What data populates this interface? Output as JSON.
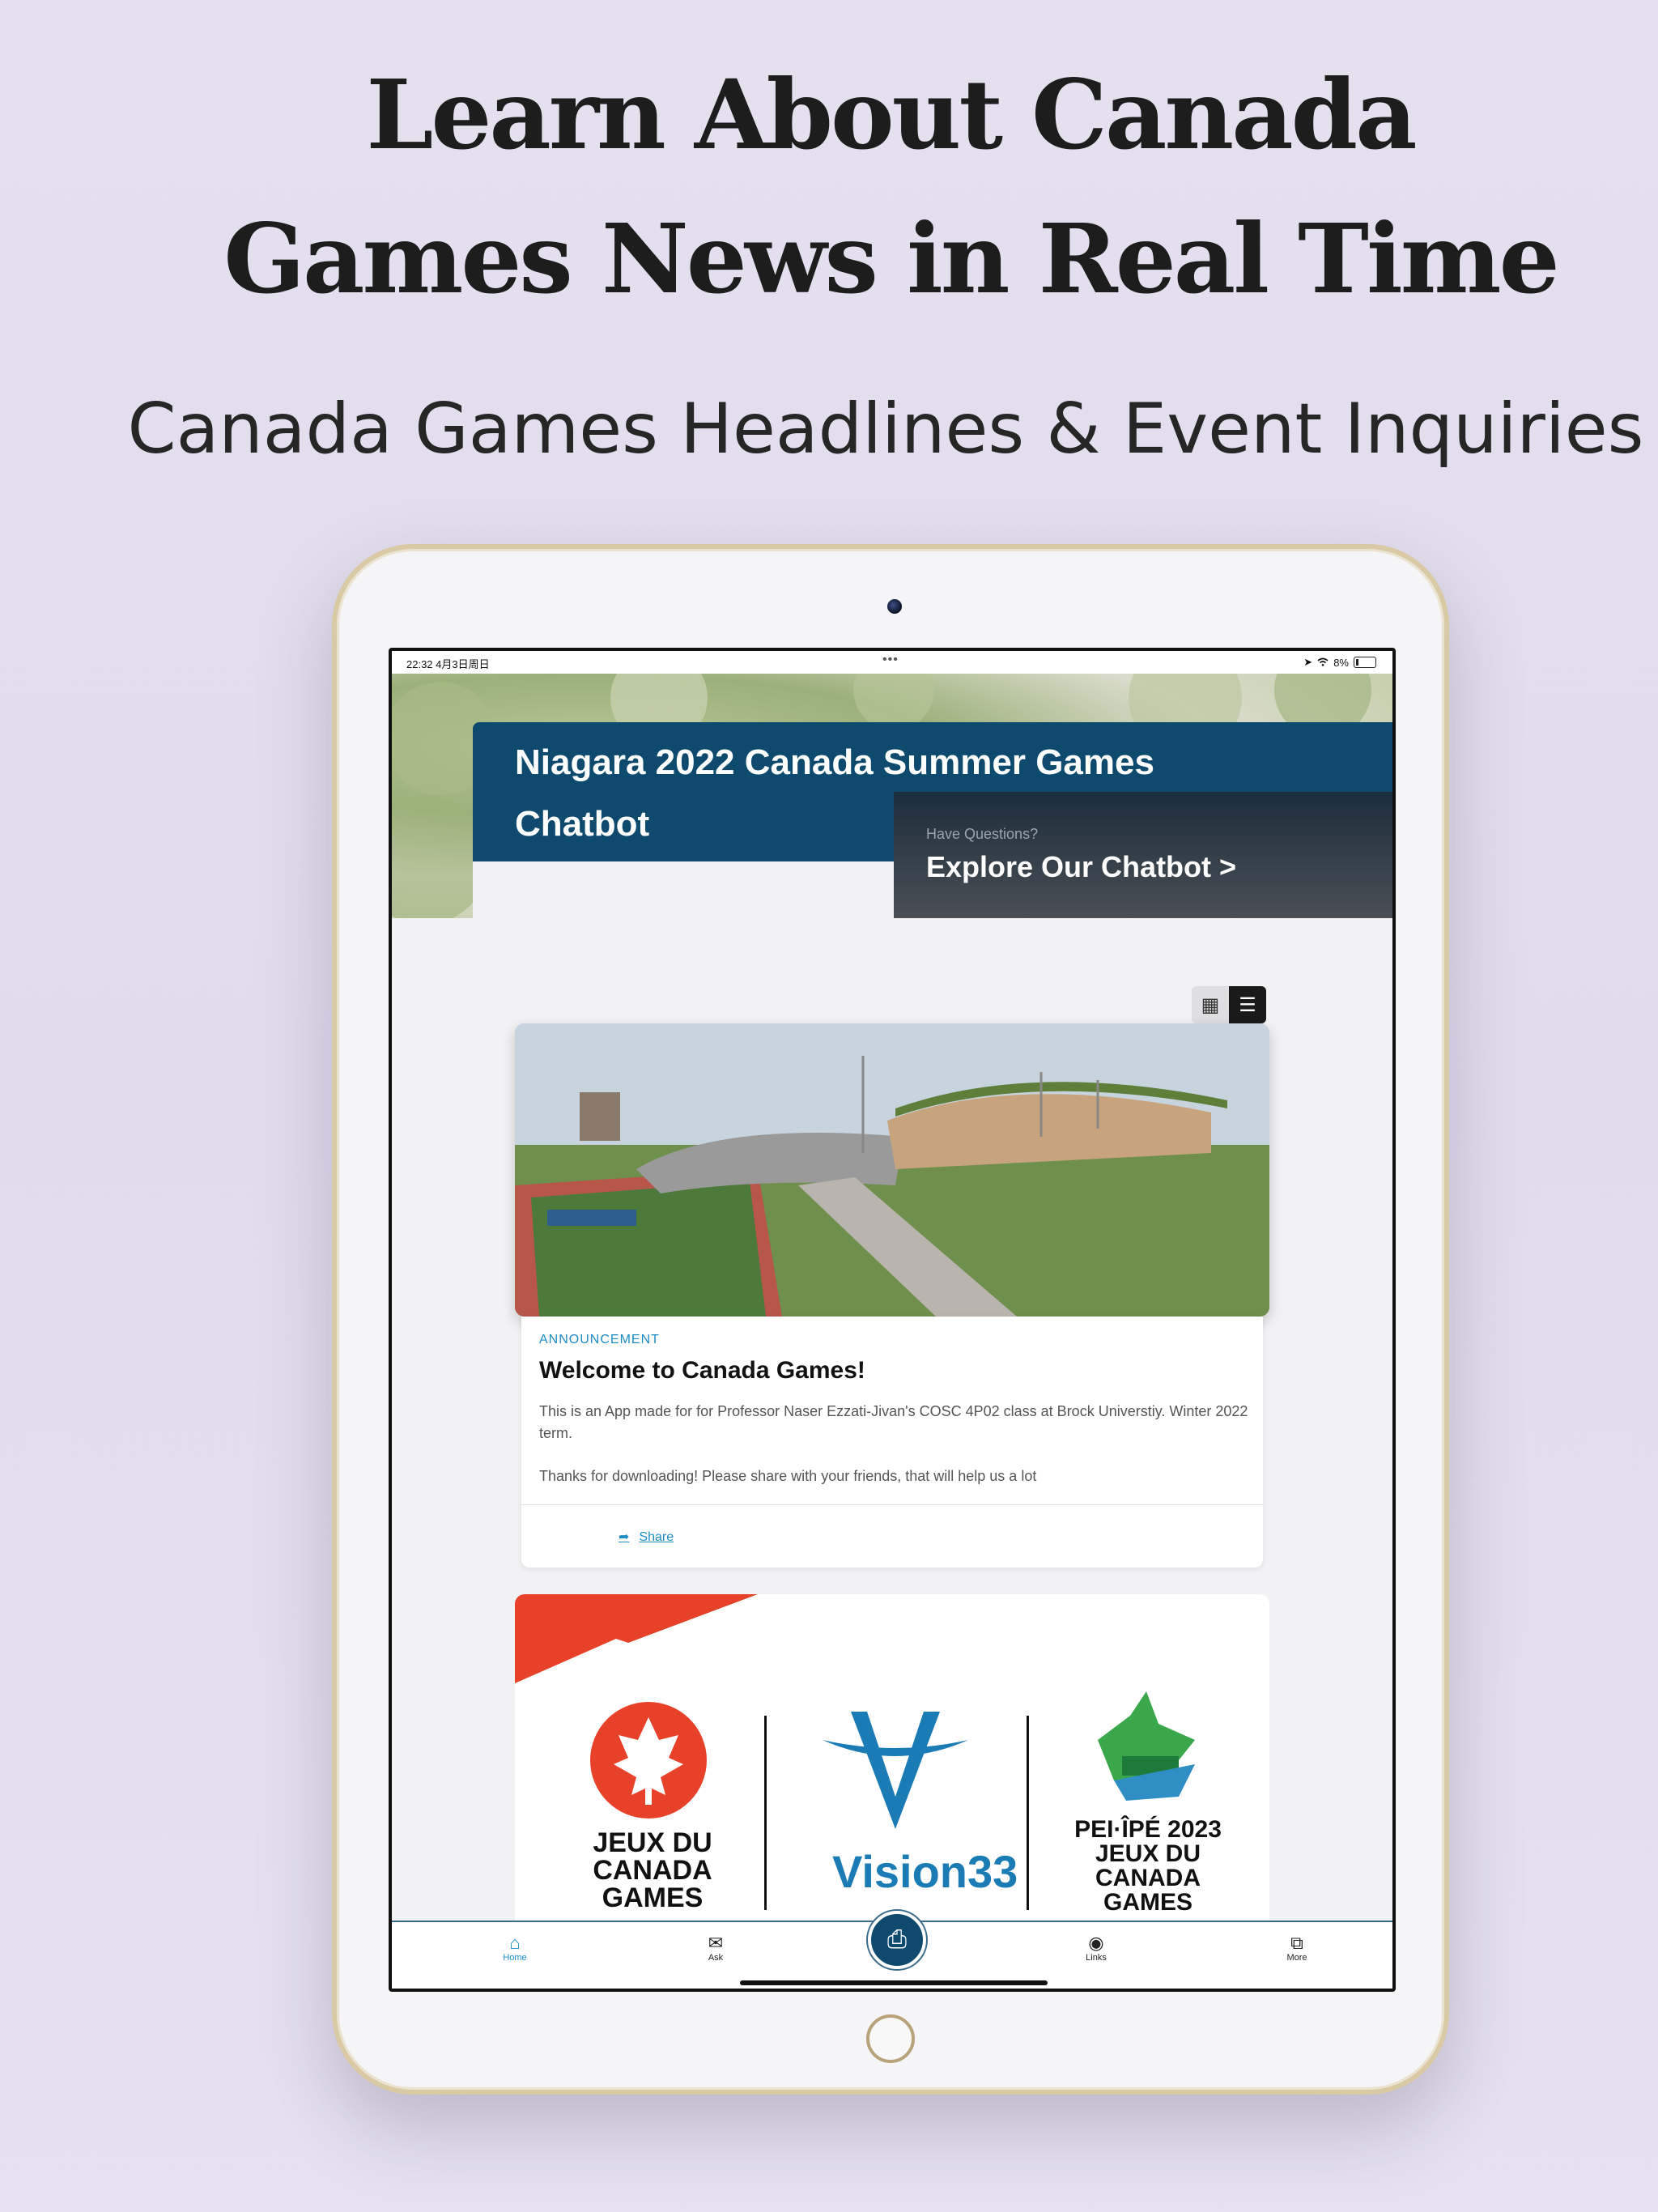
{
  "promo": {
    "headline_line1": "Learn About Canada",
    "headline_line2": "Games News in Real Time",
    "subheadline": "Canada Games Headlines & Event Inquiries"
  },
  "status_bar": {
    "time_date": "22:32  4月3日周日",
    "battery": "8%"
  },
  "hero": {
    "title": "Niagara 2022 Canada Summer Games Chatbot",
    "cta_small": "Have Questions?",
    "cta_big": "Explore Our Chatbot >"
  },
  "view_toggle": {
    "grid_icon": "grid-icon",
    "list_icon": "list-icon",
    "selected": "list"
  },
  "feed": [
    {
      "tag": "ANNOUNCEMENT",
      "title": "Welcome to Canada Games!",
      "paragraphs": [
        "This is an App made for for Professor Naser Ezzati-Jivan's COSC 4P02 class at Brock Universtiy. Winter 2022 term.",
        "Thanks for downloading! Please share with your friends, that will help us a lot"
      ],
      "share_label": "Share"
    }
  ],
  "logos": {
    "left": "JEUX DU CANADA GAMES",
    "middle": "Vision33",
    "right": "PEI·ÎPÉ 2023 JEUX DU CANADA GAMES"
  },
  "tabs": [
    {
      "label": "Home",
      "icon": "home-icon",
      "active": true
    },
    {
      "label": "Ask",
      "icon": "mail-icon",
      "active": false
    },
    {
      "label": "",
      "icon": "printer-icon",
      "active": false
    },
    {
      "label": "Links",
      "icon": "person-icon",
      "active": false
    },
    {
      "label": "More",
      "icon": "share-out-icon",
      "active": false
    }
  ],
  "colors": {
    "primary": "#0e4a6e",
    "accent": "#1d8cc4",
    "red": "#e8412a",
    "background": "#e2deee"
  }
}
